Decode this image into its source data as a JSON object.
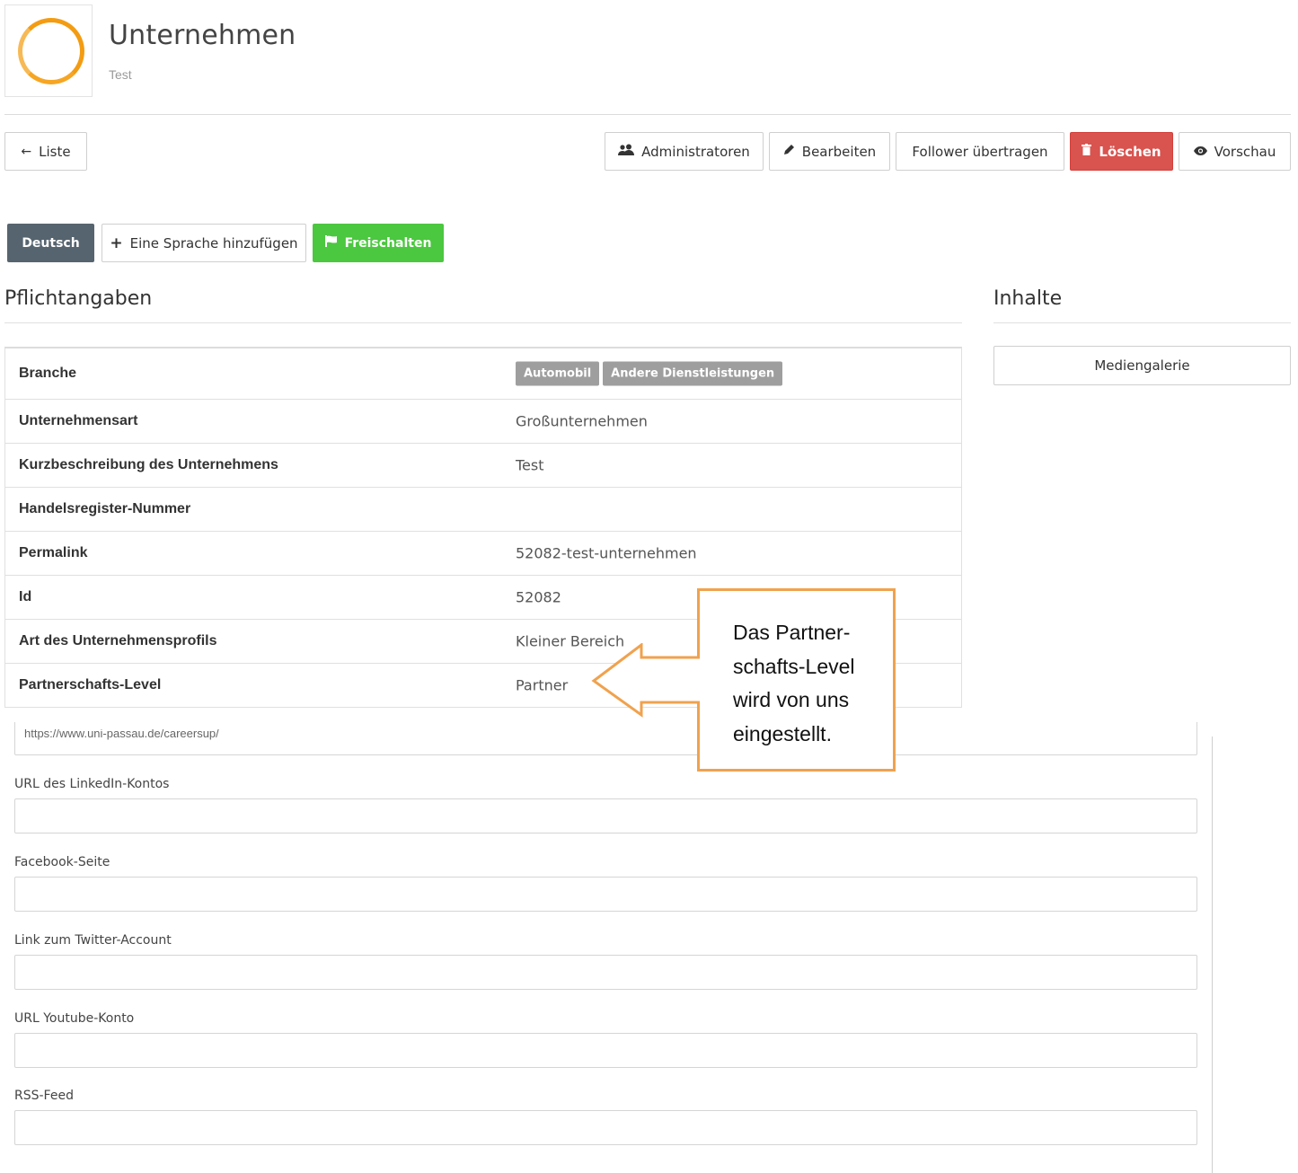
{
  "header": {
    "title": "Unternehmen",
    "subtitle": "Test"
  },
  "toolbar": {
    "back_label": "Liste",
    "admins_label": "Administratoren",
    "edit_label": "Bearbeiten",
    "transfer_label": "Follower übertragen",
    "delete_label": "Löschen",
    "preview_label": "Vorschau"
  },
  "language_bar": {
    "current_language": "Deutsch",
    "add_language_label": "Eine Sprache hinzufügen",
    "publish_label": "Freischalten"
  },
  "sections": {
    "required_title": "Pflichtangaben",
    "content_title": "Inhalte",
    "media_gallery_label": "Mediengalerie"
  },
  "details": {
    "rows": [
      {
        "label": "Branche",
        "value": "",
        "tags": [
          "Automobil",
          "Andere Dienstleistungen"
        ]
      },
      {
        "label": "Unternehmensart",
        "value": "Großunternehmen"
      },
      {
        "label": "Kurzbeschreibung des Unternehmens",
        "value": "Test"
      },
      {
        "label": "Handelsregister-Nummer",
        "value": ""
      },
      {
        "label": "Permalink",
        "value": "52082-test-unternehmen"
      },
      {
        "label": "Id",
        "value": "52082"
      },
      {
        "label": "Art des Unternehmensprofils",
        "value": "Kleiner Bereich"
      },
      {
        "label": "Partnerschafts-Level",
        "value": "Partner"
      }
    ]
  },
  "form": {
    "cut_off_value": "https://www.uni-passau.de/careersup/",
    "fields": [
      {
        "label": "URL des LinkedIn-Kontos",
        "value": ""
      },
      {
        "label": "Facebook-Seite",
        "value": ""
      },
      {
        "label": "Link zum Twitter-Account",
        "value": ""
      },
      {
        "label": "URL Youtube-Konto",
        "value": ""
      },
      {
        "label": "RSS-Feed",
        "value": ""
      }
    ]
  },
  "callout": {
    "lines": [
      "Das Partner-",
      "schafts-Level",
      "wird von uns",
      "eingestellt."
    ]
  },
  "colors": {
    "accent_orange": "#f0a24e",
    "danger": "#d9534f",
    "success": "#4cc740",
    "language_active": "#56646f",
    "tag_gray": "#9e9e9e"
  },
  "icons": {
    "back": "arrow-left-icon",
    "admins": "users-icon",
    "edit": "pencil-icon",
    "delete": "trash-icon",
    "preview": "eye-icon",
    "add": "plus-icon",
    "publish": "flag-icon",
    "logo": "ring-logo-icon"
  }
}
